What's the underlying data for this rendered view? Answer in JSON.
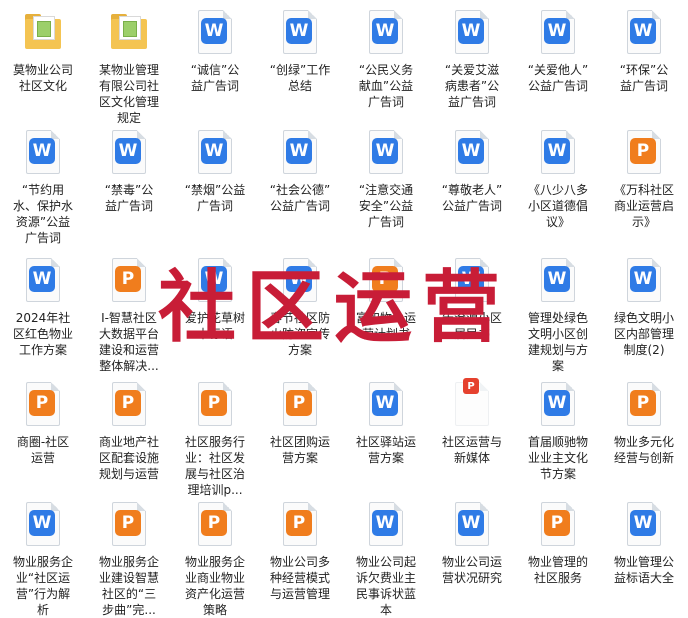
{
  "overlay_text": "社区运营",
  "files": [
    {
      "icon": "folder",
      "lines": [
        "莫物业公司",
        "社区文化"
      ]
    },
    {
      "icon": "folder",
      "lines": [
        "某物业管理",
        "有限公司社",
        "区文化管理",
        "规定"
      ]
    },
    {
      "icon": "W",
      "lines": [
        "“诚信”公",
        "益广告词"
      ]
    },
    {
      "icon": "W",
      "lines": [
        "“创绿”工作",
        "总结"
      ]
    },
    {
      "icon": "W",
      "lines": [
        "“公民义务",
        "献血”公益",
        "广告词"
      ]
    },
    {
      "icon": "W",
      "lines": [
        "“关爱艾滋",
        "病患者”公",
        "益广告词"
      ]
    },
    {
      "icon": "W",
      "lines": [
        "“关爱他人”",
        "公益广告词"
      ]
    },
    {
      "icon": "W",
      "lines": [
        "“环保”公",
        "益广告词"
      ]
    },
    {
      "icon": "W",
      "lines": [
        "“节约用",
        "水、保护水",
        "资源”公益",
        "广告词"
      ]
    },
    {
      "icon": "W",
      "lines": [
        "“禁毒”公",
        "益广告词"
      ]
    },
    {
      "icon": "W",
      "lines": [
        "“禁烟”公益",
        "广告词"
      ]
    },
    {
      "icon": "W",
      "lines": [
        "“社会公德”",
        "公益广告词"
      ]
    },
    {
      "icon": "W",
      "lines": [
        "“注意交通",
        "安全”公益",
        "广告词"
      ]
    },
    {
      "icon": "W",
      "lines": [
        "“尊敬老人”",
        "公益广告词"
      ]
    },
    {
      "icon": "W",
      "lines": [
        "《八少八多",
        "小区道德倡",
        "议》"
      ]
    },
    {
      "icon": "P",
      "lines": [
        "《万科社区",
        "商业运营启",
        "示》"
      ]
    },
    {
      "icon": "W",
      "lines": [
        "2024年社",
        "区红色物业",
        "工作方案"
      ]
    },
    {
      "icon": "P",
      "lines": [
        "I-智慧社区",
        "大数据平台",
        "建设和运营",
        "整体解决..."
      ]
    },
    {
      "icon": "W",
      "lines": [
        "爱护花草树",
        "木标语"
      ]
    },
    {
      "icon": "W",
      "lines": [
        "春节社区防",
        "火防盗宣传",
        "方案"
      ]
    },
    {
      "icon": "P",
      "lines": [
        "富和物业运",
        "营计划书"
      ]
    },
    {
      "icon": "W",
      "lines": [
        "告沧源小区",
        "居民书"
      ]
    },
    {
      "icon": "W",
      "lines": [
        "管理处绿色",
        "文明小区创",
        "建规划与方",
        "案"
      ]
    },
    {
      "icon": "W",
      "lines": [
        "绿色文明小",
        "区内部管理",
        "制度(2)"
      ]
    },
    {
      "icon": "P",
      "lines": [
        "商圈-社区",
        "运营"
      ]
    },
    {
      "icon": "P",
      "lines": [
        "商业地产社",
        "区配套设施",
        "规划与运营"
      ]
    },
    {
      "icon": "P",
      "lines": [
        "社区服务行",
        "业：社区发",
        "展与社区治",
        "理培训p..."
      ]
    },
    {
      "icon": "P",
      "lines": [
        "社区团购运",
        "营方案"
      ]
    },
    {
      "icon": "W",
      "lines": [
        "社区驿站运",
        "营方案"
      ]
    },
    {
      "icon": "Psmall",
      "lines": [
        "社区运营与",
        "新媒体"
      ]
    },
    {
      "icon": "W",
      "lines": [
        "首届顺驰物",
        "业业主文化",
        "节方案"
      ]
    },
    {
      "icon": "P",
      "lines": [
        "物业多元化",
        "经营与创新"
      ]
    },
    {
      "icon": "W",
      "lines": [
        "物业服务企",
        "业“社区运",
        "营”行为解",
        "析"
      ]
    },
    {
      "icon": "P",
      "lines": [
        "物业服务企",
        "业建设智慧",
        "社区的“三",
        "步曲”完..."
      ]
    },
    {
      "icon": "P",
      "lines": [
        "物业服务企",
        "业商业物业",
        "资产化运营",
        "策略"
      ]
    },
    {
      "icon": "P",
      "lines": [
        "物业公司多",
        "种经营模式",
        "与运营管理"
      ]
    },
    {
      "icon": "W",
      "lines": [
        "物业公司起",
        "诉欠费业主",
        "民事诉状蓝",
        "本"
      ]
    },
    {
      "icon": "W",
      "lines": [
        "物业公司运",
        "营状况研究"
      ]
    },
    {
      "icon": "P",
      "lines": [
        "物业管理的",
        "社区服务"
      ]
    },
    {
      "icon": "W",
      "lines": [
        "物业管理公",
        "益标语大全"
      ]
    }
  ]
}
